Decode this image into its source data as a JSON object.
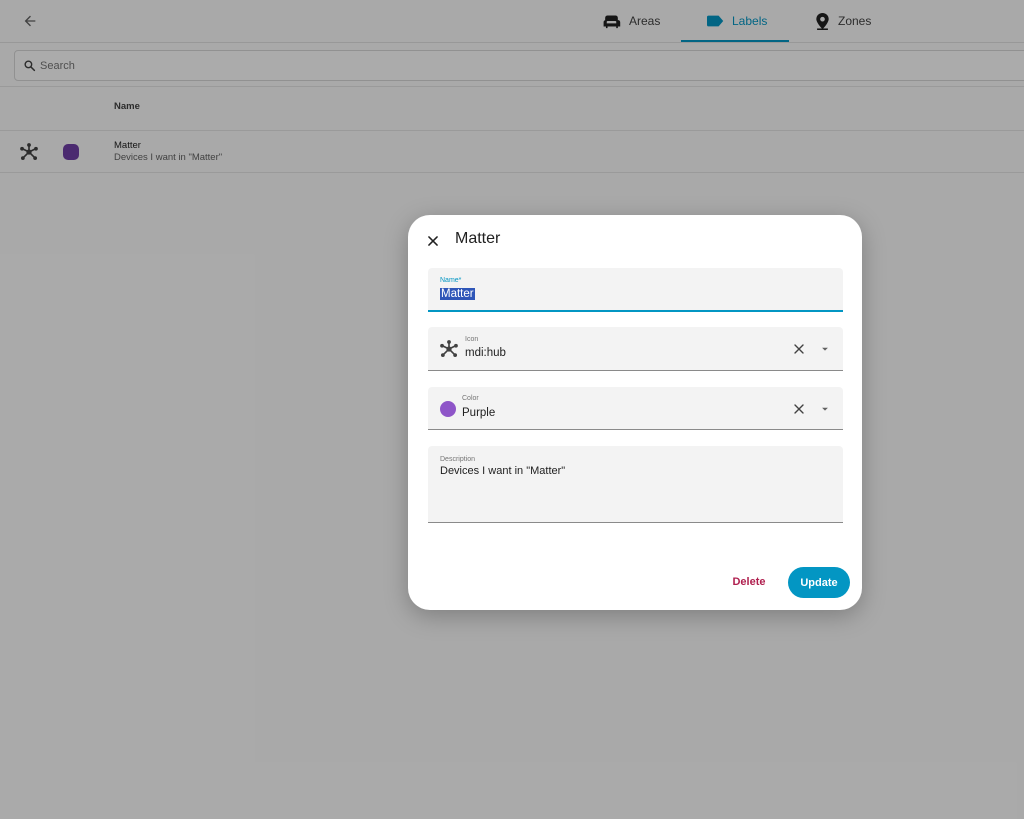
{
  "colors": {
    "accent": "#0396c3",
    "purple": "#8e55c8",
    "delete": "#b0204f",
    "row_color": "#6f3fa6"
  },
  "header": {
    "back_icon": "arrow-left-icon",
    "tabs": [
      {
        "label": "Areas",
        "icon": "sofa-icon",
        "active": false
      },
      {
        "label": "Labels",
        "icon": "label-icon",
        "active": true
      },
      {
        "label": "Zones",
        "icon": "map-marker-icon",
        "active": false
      }
    ]
  },
  "search": {
    "placeholder": "Search",
    "value": ""
  },
  "table": {
    "columns": [
      "Name"
    ],
    "rows": [
      {
        "icon": "hub-icon",
        "title": "Matter",
        "description": "Devices I want in \"Matter\""
      }
    ]
  },
  "dialog": {
    "title": "Matter",
    "fields": {
      "name": {
        "label": "Name*",
        "value": "Matter"
      },
      "icon": {
        "label": "Icon",
        "value": "mdi:hub"
      },
      "color": {
        "label": "Color",
        "value": "Purple"
      },
      "description": {
        "label": "Description",
        "value": "Devices I want in \"Matter\""
      }
    },
    "buttons": {
      "delete": "Delete",
      "update": "Update"
    }
  }
}
